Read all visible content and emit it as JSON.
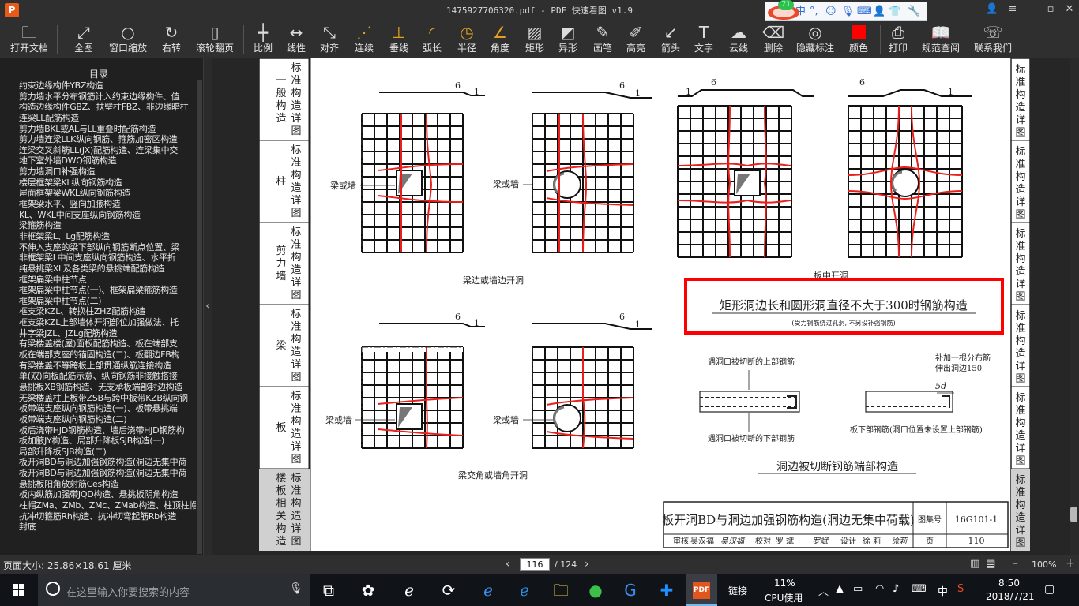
{
  "window": {
    "title": "1475927706320.pdf - PDF 快速看图 v1.9",
    "logo_text": "P",
    "ime_badge": "71"
  },
  "toolbar": [
    {
      "label": "打开文档",
      "icon": "folder-icon"
    },
    {
      "label": "全图",
      "icon": "fit-page-icon"
    },
    {
      "label": "窗口缩放",
      "icon": "zoom-icon"
    },
    {
      "label": "右转",
      "icon": "rotate-right-icon"
    },
    {
      "label": "滚轮翻页",
      "icon": "mouse-scroll-icon"
    },
    {
      "label": "比例",
      "icon": "ruler-icon"
    },
    {
      "label": "线性",
      "icon": "linear-measure-icon"
    },
    {
      "label": "对齐",
      "icon": "aligned-measure-icon"
    },
    {
      "label": "连续",
      "icon": "continuous-measure-icon"
    },
    {
      "label": "垂线",
      "icon": "perpendicular-icon"
    },
    {
      "label": "弧长",
      "icon": "arc-length-icon"
    },
    {
      "label": "半径",
      "icon": "radius-icon"
    },
    {
      "label": "角度",
      "icon": "angle-icon"
    },
    {
      "label": "矩形",
      "icon": "rectangle-icon"
    },
    {
      "label": "异形",
      "icon": "polygon-icon"
    },
    {
      "label": "画笔",
      "icon": "pen-icon"
    },
    {
      "label": "高亮",
      "icon": "highlighter-icon"
    },
    {
      "label": "箭头",
      "icon": "arrow-icon"
    },
    {
      "label": "文字",
      "icon": "text-icon"
    },
    {
      "label": "云线",
      "icon": "cloud-line-icon"
    },
    {
      "label": "删除",
      "icon": "eraser-icon"
    },
    {
      "label": "隐藏标注",
      "icon": "eye-hide-icon"
    },
    {
      "label": "颜色",
      "icon": "color-swatch-icon",
      "color": "#ff0000"
    },
    {
      "label": "打印",
      "icon": "printer-icon"
    },
    {
      "label": "规范查阅",
      "icon": "book-icon"
    },
    {
      "label": "联系我们",
      "icon": "support-icon"
    }
  ],
  "toc": {
    "title": "目录",
    "items": [
      "约束边缘构件YBZ构造",
      "剪力墙水平分布钢筋计入约束边缘构件、值",
      "构造边缘构件GBZ、扶壁柱FBZ、非边缘暗柱",
      "连梁LL配筋构造",
      "剪力墙BKL或AL与LL重叠时配筋构造",
      "剪力墙连梁LLK纵向钢筋、箍筋加密区构造",
      "连梁交叉斜筋LL(JX)配筋构造、连梁集中交",
      "地下室外墙DWQ钢筋构造",
      "剪力墙洞口补强构造",
      "楼层框架梁KL纵向钢筋构造",
      "屋面框架梁WKL纵向钢筋构造",
      "框架梁水平、竖向加腋构造",
      "KL、WKL中间支座纵向钢筋构造",
      "梁箍筋构造",
      "非框架梁L、Lg配筋构造",
      "不伸入支座的梁下部纵向钢筋断点位置、梁",
      "非框架梁L中间支座纵向钢筋构造、水平折",
      "纯悬挑梁XL及各类梁的悬挑端配筋构造",
      "框架扁梁中柱节点",
      "框架扁梁中柱节点(一)、框架扁梁箍筋构造",
      "框架扁梁中柱节点(二)",
      "框支梁KZL、转换柱ZHZ配筋构造",
      "框支梁KZL上部墙体开洞部位加强做法、托",
      "井字梁JZL、JZLg配筋构造",
      "有梁楼盖楼(屋)面板配筋构造、板在端部支",
      "板在端部支座的锚固构造(二)、板翻边FB构",
      "有梁楼盖不等跨板上部贯通纵筋连接构造",
      "单(双)向板配筋示意、纵向钢筋非接触搭接",
      "悬挑板XB钢筋构造、无支承板端部封边构造",
      "无梁楼盖柱上板带ZSB与跨中板带KZB纵向钢",
      "板带端支座纵向钢筋构造(一)、板带悬挑端",
      "板带端支座纵向钢筋构造(二)",
      "板后浇带HJD钢筋构造、墙后浇带HJD钢筋构",
      "板加腋JY构造、局部升降板SJB构造(一)",
      "局部升降板SJB构造(二)",
      "板开洞BD与洞边加强钢筋构造(洞边无集中荷",
      "板开洞BD与洞边加强钢筋构造(洞边无集中荷",
      "悬挑板阳角放射筋Ces构造",
      "板内纵筋加强带JQD构造、悬挑板阴角构造",
      "柱帽ZMa、ZMb、ZMc、ZMab构造、柱顶柱帽",
      "抗冲切箍筋Rh构造、抗冲切弯起筋Rb构造",
      "封底"
    ]
  },
  "drawing": {
    "left_tabs": [
      {
        "head": "一般构造",
        "tail": "标准构造详图"
      },
      {
        "head": "柱",
        "tail": "标准构造详图"
      },
      {
        "head": "剪力墙",
        "tail": "标准构造详图"
      },
      {
        "head": "梁",
        "tail": "标准构造详图"
      },
      {
        "head": "板",
        "tail": "标准构造详图"
      },
      {
        "head": "楼板相关构造",
        "tail": "标准构造详图"
      }
    ],
    "right_tabs": [
      "标准构造详图",
      "标准构造详图",
      "标准构造详图",
      "标准构造详图",
      "标准构造详图",
      "标准构造详图"
    ],
    "dim_6": "6",
    "dim_1": "1",
    "beam_or_wall": "梁或墙",
    "caption_edge": "梁边或墙边开洞",
    "caption_middle": "板中开洞",
    "caption_corner": "梁交角或墙角开洞",
    "highlight_title": "矩形洞边长和圆形洞直径不大于300时钢筋构造",
    "highlight_sub": "(受力钢筋绕过孔洞, 不另设补强钢筋)",
    "upper_cut": "遇洞口被切断的上部钢筋",
    "lower_cut": "遇洞口被切断的下部钢筋",
    "add_dist_1": "补加一根分布筋",
    "add_dist_2": "伸出洞边150",
    "five_d": "5d",
    "lower_bar_note": "板下部钢筋(洞口位置未设置上部钢筋)",
    "end_caption": "洞边被切断钢筋端部构造",
    "title_block": {
      "title": "板开洞BD与洞边加强钢筋构造(洞边无集中荷载)",
      "atlas_label": "图集号",
      "atlas_no": "16G101-1",
      "review_label": "审核",
      "reviewer": "吴汉福",
      "reviewer_sig": "吴汉福",
      "check_label": "校对",
      "checker": "罗 斌",
      "checker_sig": "罗斌",
      "design_label": "设计",
      "designer": "徐 莉",
      "designer_sig": "徐莉",
      "page_label": "页",
      "page_no": "110"
    }
  },
  "status": {
    "page_size": "页面大小: 25.86×18.61 厘米",
    "current_page": "116",
    "total_pages": "/ 124",
    "zoom": "100%"
  },
  "taskbar": {
    "search_placeholder": "在这里输入你要搜索的内容",
    "tray_link": "链接",
    "cpu_percent": "11%",
    "cpu_label": "CPU使用",
    "ime_mode": "中",
    "time": "8:50",
    "date": "2018/7/21"
  },
  "colors": {
    "highlight_box": "#ff0000",
    "rebar_red": "#e8201c",
    "toolbar_bg": "#2f2f2f"
  }
}
